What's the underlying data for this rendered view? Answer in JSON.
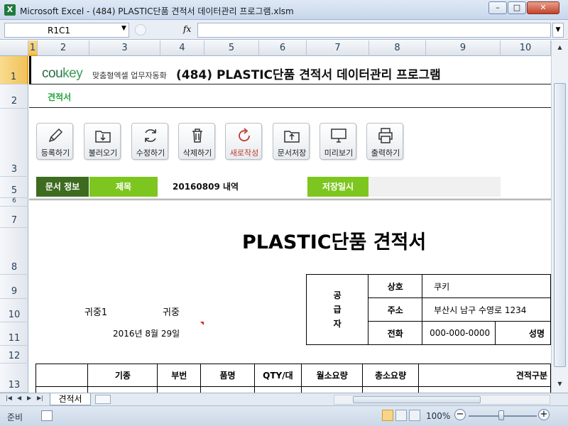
{
  "window": {
    "title": "Microsoft Excel - (484) PLASTIC단품 견적서 데이터관리 프로그램.xlsm",
    "btn_min": "–",
    "btn_max": "□",
    "btn_close": "✕"
  },
  "formula_bar": {
    "name_box": "R1C1",
    "fx": "fx",
    "value": ""
  },
  "columns": [
    "1",
    "2",
    "3",
    "4",
    "5",
    "6",
    "7",
    "8",
    "9",
    "10"
  ],
  "rows": [
    "1",
    "2",
    "3",
    "5",
    "6",
    "7",
    "8",
    "9",
    "10",
    "11",
    "12",
    "13"
  ],
  "header": {
    "logo_main": "cou",
    "logo_accent": "key",
    "logo_sub": "맞춤형엑셀 업무자동화",
    "program_title": "(484) PLASTIC단품 견적서 데이터관리 프로그램",
    "sheet_label": "견적서"
  },
  "toolbar": [
    {
      "label": "등록하기",
      "icon": "pencil-icon"
    },
    {
      "label": "불러오기",
      "icon": "folder-download-icon"
    },
    {
      "label": "수정하기",
      "icon": "refresh-icon"
    },
    {
      "label": "삭제하기",
      "icon": "trash-icon"
    },
    {
      "label": "새로작성",
      "icon": "new-document-icon"
    },
    {
      "label": "문서저장",
      "icon": "folder-upload-icon"
    },
    {
      "label": "미리보기",
      "icon": "monitor-icon"
    },
    {
      "label": "출력하기",
      "icon": "printer-icon"
    }
  ],
  "doc_info": {
    "label": "문서 정보",
    "title_label": "제목",
    "title_value": "20160809 내역",
    "saved_label": "저장일시",
    "saved_value": ""
  },
  "estimate": {
    "title": "PLASTIC단품 견적서",
    "recipient": "귀중1",
    "honorific": "귀중",
    "date": "2016년 8월 29일",
    "supplier_label": "공\n급\n자",
    "supplier": {
      "name_label": "상호",
      "name": "쿠키",
      "address_label": "주소",
      "address": "부산시 남구 수영로 1234",
      "phone_label": "전화",
      "phone": "000-000-0000",
      "ceo_label": "성명"
    },
    "item_headers": [
      "기종",
      "부번",
      "품명",
      "QTY/대",
      "월소요량",
      "총소요량",
      "견적구분"
    ]
  },
  "sheet_tabs": [
    "견적서"
  ],
  "status": {
    "text": "준비",
    "zoom": "100%"
  }
}
